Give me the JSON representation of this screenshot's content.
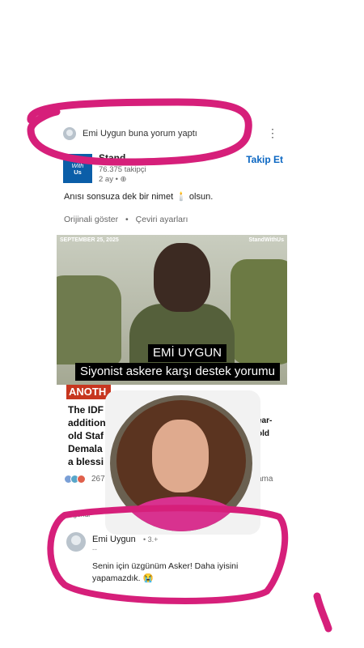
{
  "activity": {
    "text": "Emi Uygun buna yorum yaptı",
    "menu_icon": "⋮"
  },
  "company": {
    "logo_line1": "Stand",
    "logo_line2": "With",
    "logo_line3": "Us",
    "name": "Stand",
    "followers": "76.375 takipçi",
    "meta": "2 ay • ⊕",
    "follow_label": "Takip Et"
  },
  "post": {
    "text": "Anısı sonsuza dek bir nimet 🕯️ olsun.",
    "show_original": "Orijinali göster",
    "separator": "•",
    "translation_settings": "Çeviri ayarları"
  },
  "post_image": {
    "date": "SEPTEMBER 25, 2025",
    "watermark": "StandWithUs",
    "tag": "ANOTH",
    "headline": "The IDF\naddition\nold Staf\nDemala\na blessi",
    "headline_right": "ear-\nold"
  },
  "reactions": {
    "count": "267",
    "reposts": "ama"
  },
  "comments": {
    "relevance": "Beğendi",
    "name": "Emi Uygun",
    "degree": "• 3.+",
    "dash": "--",
    "body": "Senin için üzgünüm Asker! Daha iyisini yapamazdık. 😭"
  },
  "overlay": {
    "caption_line1": "EMİ UYGUN",
    "caption_line2": "Siyonist askere karşı destek yorumu"
  },
  "colors": {
    "accent_link": "#0a66c2",
    "logo_bg": "#0b5ea8",
    "highlight_stroke": "#d61f7a",
    "caption_bg": "#000000"
  }
}
